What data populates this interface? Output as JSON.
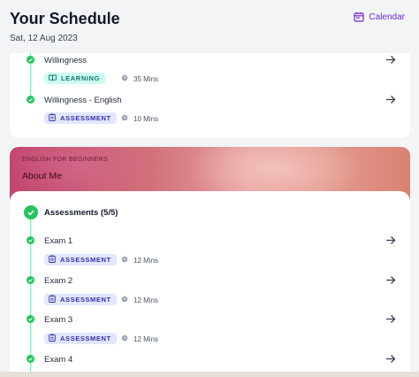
{
  "header": {
    "title": "Your Schedule",
    "date": "Sat, 12 Aug 2023",
    "calendar_label": "Calendar"
  },
  "colors": {
    "accent": "#6d28d9",
    "success": "#22c55e",
    "learning_bg": "#ccfbf1",
    "assessment_bg": "#e0e7ff"
  },
  "top_card": {
    "items": [
      {
        "title": "Willingness",
        "badge": "LEARNING",
        "badge_type": "learning",
        "duration": "35 Mins",
        "icon": "book-icon"
      },
      {
        "title": "Willingness - English",
        "badge": "ASSESSMENT",
        "badge_type": "assessment",
        "duration": "10 Mins",
        "icon": "clipboard-icon"
      }
    ]
  },
  "course_card": {
    "subtitle": "ENGLISH FOR BEGINNERS",
    "title": "About Me",
    "section_title": "Assessments (5/5)",
    "items": [
      {
        "title": "Exam 1",
        "badge": "ASSESSMENT",
        "duration": "12 Mins"
      },
      {
        "title": "Exam 2",
        "badge": "ASSESSMENT",
        "duration": "12 Mins"
      },
      {
        "title": "Exam 3",
        "badge": "ASSESSMENT",
        "duration": "12 Mins"
      },
      {
        "title": "Exam 4"
      }
    ]
  }
}
